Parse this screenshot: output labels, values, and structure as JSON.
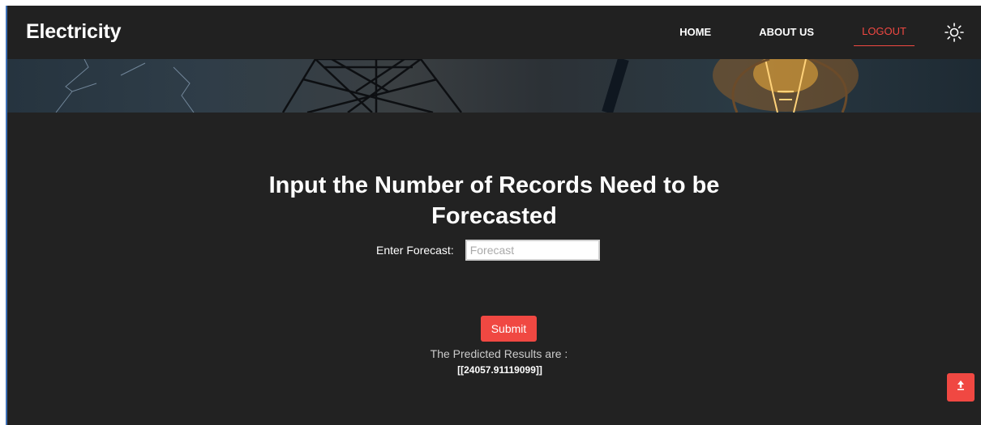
{
  "nav": {
    "brand": "Electricity",
    "links": [
      {
        "label": "HOME"
      },
      {
        "label": "ABOUT US"
      },
      {
        "label": "LOGOUT"
      }
    ]
  },
  "main": {
    "heading_line1": "Input the Number of Records Need to be",
    "heading_line2": "Forecasted",
    "form": {
      "label": "Enter Forecast:",
      "placeholder": "Forecast",
      "value": ""
    },
    "submit_label": "Submit",
    "result_label": "The Predicted Results are :",
    "result_value": "[[24057.91119099]]"
  },
  "icons": {
    "theme": "sun-icon",
    "back_to_top": "arrow-up-icon"
  },
  "colors": {
    "accent": "#f04842",
    "background": "#222222",
    "navbar": "#212121"
  }
}
